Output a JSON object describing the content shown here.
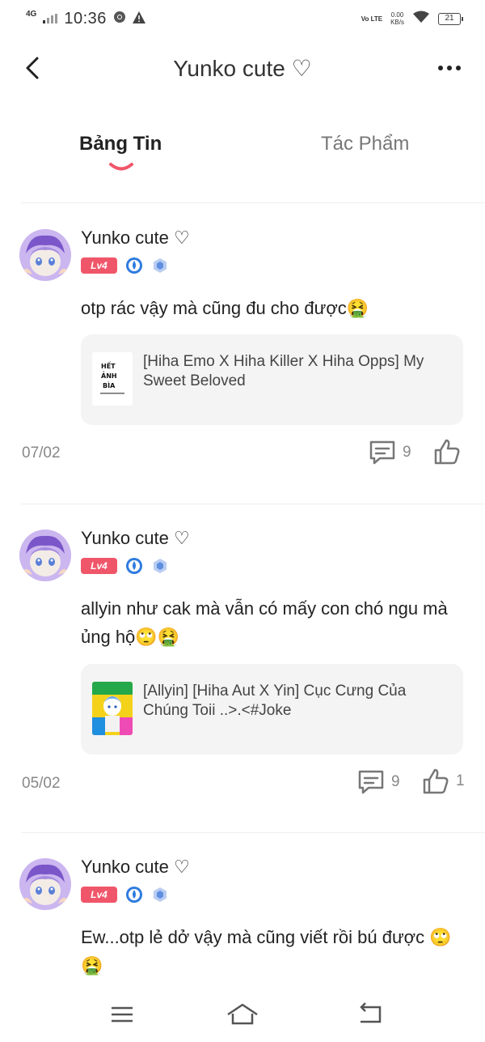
{
  "status_bar": {
    "network": "4G",
    "time": "10:36",
    "volte": "Vo LTE",
    "speed_value": "0.00",
    "speed_unit": "KB/s",
    "battery": "21"
  },
  "header": {
    "title": "Yunko cute ♡"
  },
  "tabs": [
    {
      "label": "Bảng Tin",
      "active": true
    },
    {
      "label": "Tác Phẩm",
      "active": false
    }
  ],
  "posts": [
    {
      "author": "Yunko cute ♡",
      "level": "Lv4",
      "text": "otp rác vậy mà cũng đu cho được🤮",
      "card_title": "[Hiha Emo X Hiha Killer X Hiha Opps] My Sweet Beloved",
      "date": "07/02",
      "comments": "9",
      "likes": ""
    },
    {
      "author": "Yunko cute ♡",
      "level": "Lv4",
      "text": "allyin như cak mà vẫn có mấy con chó ngu mà ủng hộ🙄🤮",
      "card_title": "[Allyin] [Hiha Aut X Yin] Cục Cưng Của Chúng Toii ..>.<#Joke",
      "date": "05/02",
      "comments": "9",
      "likes": "1"
    },
    {
      "author": "Yunko cute ♡",
      "level": "Lv4",
      "text": "Ew...otp lẻ dở vậy mà cũng viết rồi bú được 🙄🤮"
    }
  ],
  "thumbs": {
    "post0_text": "Hết ảnh bìa"
  },
  "icons": {
    "back": "chevron-left-icon",
    "more": "more-dots-icon",
    "comment": "comment-icon",
    "like": "thumbs-up-icon",
    "menu": "menu-icon",
    "home": "home-icon",
    "return": "back-nav-icon"
  },
  "colors": {
    "accent": "#f0566a",
    "badge_blue": "#2f7be0"
  }
}
